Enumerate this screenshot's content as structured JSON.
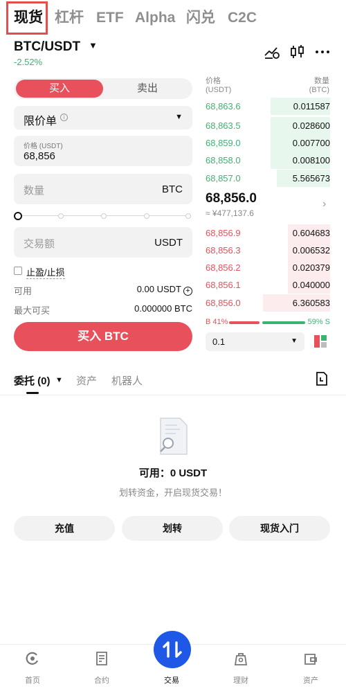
{
  "top_tabs": [
    {
      "label": "现货",
      "active": true
    },
    {
      "label": "杠杆"
    },
    {
      "label": "ETF"
    },
    {
      "label": "Alpha"
    },
    {
      "label": "闪兑"
    },
    {
      "label": "C2C"
    }
  ],
  "pair": {
    "symbol": "BTC/USDT",
    "change": "-2.52%"
  },
  "header_icons": [
    "price-alert-icon",
    "candlestick-icon",
    "more-icon"
  ],
  "form": {
    "buy_label": "买入",
    "sell_label": "卖出",
    "order_type": "限价单",
    "info_glyph": "i",
    "price_label": "价格 (USDT)",
    "price_value": "68,856",
    "amount_placeholder": "数量",
    "amount_unit": "BTC",
    "slider_value": 0,
    "total_placeholder": "交易额",
    "total_unit": "USDT",
    "tpsl_label": "止盈/止损",
    "available_label": "可用",
    "available_value": "0.00 USDT",
    "max_buy_label": "最大可买",
    "max_buy_value": "0.000000 BTC",
    "submit_label": "买入 BTC"
  },
  "orderbook": {
    "price_header": "价格",
    "price_unit": "(USDT)",
    "qty_header": "数量",
    "qty_unit": "(BTC)",
    "asks": [
      {
        "price": "68,863.6",
        "qty": "0.011587",
        "depth": 0.48
      },
      {
        "price": "68,863.5",
        "qty": "0.028600",
        "depth": 0.48
      },
      {
        "price": "68,859.0",
        "qty": "0.007700",
        "depth": 0.48
      },
      {
        "price": "68,858.0",
        "qty": "0.008100",
        "depth": 0.48
      },
      {
        "price": "68,857.0",
        "qty": "5.565673",
        "depth": 0.43
      }
    ],
    "mid_price": "68,856.0",
    "mid_fiat": "≈ ¥477,137.6",
    "bids": [
      {
        "price": "68,856.9",
        "qty": "0.604683",
        "depth": 0.34
      },
      {
        "price": "68,856.3",
        "qty": "0.006532",
        "depth": 0.34
      },
      {
        "price": "68,856.2",
        "qty": "0.020379",
        "depth": 0.34
      },
      {
        "price": "68,856.1",
        "qty": "0.040000",
        "depth": 0.34
      },
      {
        "price": "68,856.0",
        "qty": "6.360583",
        "depth": 0.54
      }
    ],
    "buy_ratio": "B 41%",
    "sell_ratio": "59% S",
    "precision": "0.1"
  },
  "section_tabs": {
    "orders": "委托 (0)",
    "assets": "资产",
    "bots": "机器人"
  },
  "empty": {
    "available": "可用：0 USDT",
    "hint": "划转资金，开启现货交易！",
    "deposit": "充值",
    "transfer": "划转",
    "guide": "现货入门"
  },
  "nav": [
    {
      "label": "首页",
      "icon": "home-icon"
    },
    {
      "label": "合约",
      "icon": "futures-icon"
    },
    {
      "label": "交易",
      "icon": "trade-icon",
      "active": true
    },
    {
      "label": "理财",
      "icon": "earn-icon"
    },
    {
      "label": "资产",
      "icon": "wallet-icon"
    }
  ],
  "colors": {
    "buy": "#e8505b",
    "sell": "#3cb371",
    "brand": "#1f57e6",
    "highlight": "#e54d4d"
  }
}
